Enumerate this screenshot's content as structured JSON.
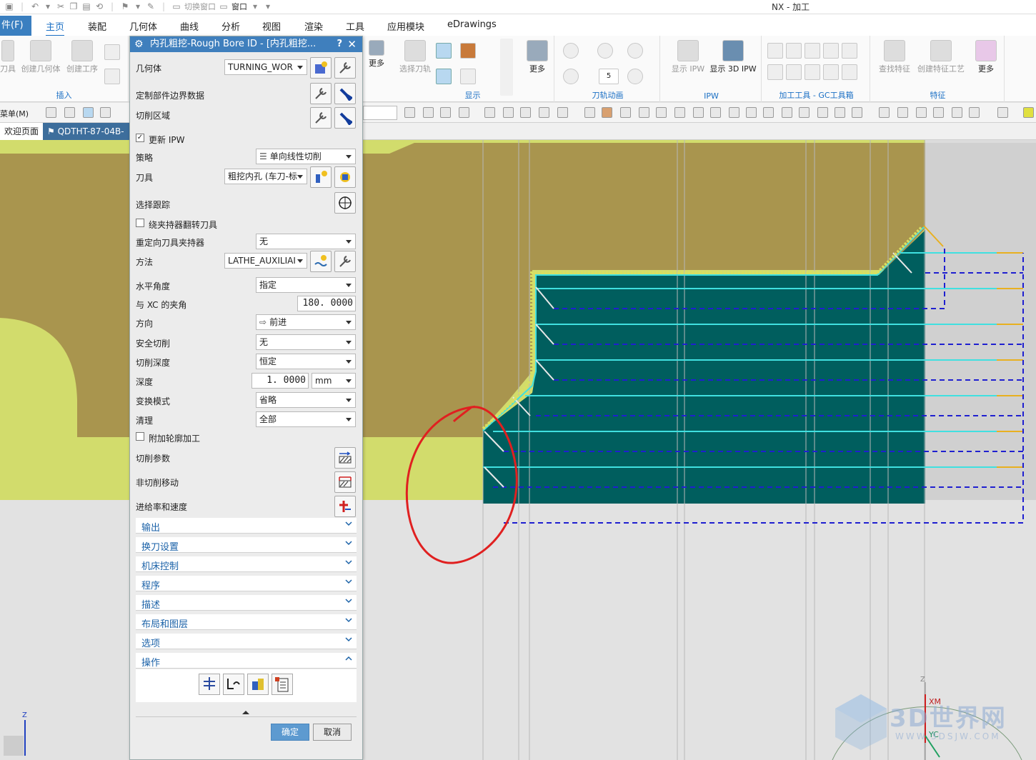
{
  "window": {
    "title": "NX - 加工"
  },
  "quick_access": {
    "switch_window": "切换窗口",
    "window_menu": "窗口"
  },
  "tabs": [
    {
      "label": "件(F)"
    },
    {
      "label": "主页"
    },
    {
      "label": "装配"
    },
    {
      "label": "几何体"
    },
    {
      "label": "曲线"
    },
    {
      "label": "分析"
    },
    {
      "label": "视图"
    },
    {
      "label": "渲染"
    },
    {
      "label": "工具"
    },
    {
      "label": "应用模块"
    },
    {
      "label": "eDrawings"
    }
  ],
  "ribbon": {
    "insert": {
      "label": "插入",
      "b1": "刀具",
      "b2": "创建几何体",
      "b3": "创建工序"
    },
    "display": {
      "label": "显示",
      "more": "更多",
      "select_path": "选择刀轨"
    },
    "anim": {
      "label": "刀轨动画",
      "more": "更多",
      "speed": "5"
    },
    "ipw": {
      "label": "IPW",
      "show_ipw": "显示 IPW",
      "show_3d_ipw": "显示 3D IPW"
    },
    "gc": {
      "label": "加工工具 - GC工具箱"
    },
    "feature": {
      "label": "特征",
      "find": "查找特征",
      "create": "创建特征工艺",
      "more": "更多"
    },
    "left_more": "更多"
  },
  "toolbar": {
    "menu": "菜单(M)"
  },
  "doctabs": {
    "home": "欢迎页面",
    "part": "QDTHT-87-04B-"
  },
  "dialog": {
    "title": "内孔粗挖-Rough Bore ID - [内孔粗挖...",
    "help": "?",
    "geometry": {
      "label": "几何体",
      "value": "TURNING_WOR"
    },
    "custom_boundary": {
      "label": "定制部件边界数据"
    },
    "cut_region": {
      "label": "切削区域"
    },
    "update_ipw": {
      "label": "更新 IPW",
      "checked": true
    },
    "strategy": {
      "label": "策略",
      "value": "单向线性切削"
    },
    "tool": {
      "label": "刀具",
      "value": "粗挖内孔 (车刀-标"
    },
    "select_trace": {
      "label": "选择跟踪"
    },
    "flip_tool": {
      "label": "绕夹持器翻转刀具",
      "checked": false
    },
    "reorient_holder": {
      "label": "重定向刀具夹持器",
      "value": "无"
    },
    "method": {
      "label": "方法",
      "value": "LATHE_AUXILIAI"
    },
    "level_angle": {
      "label": "水平角度",
      "value": "指定"
    },
    "xc_angle": {
      "label": "与 XC 的夹角",
      "value": "180. 0000"
    },
    "direction": {
      "label": "方向",
      "value": "前进"
    },
    "safe_cut": {
      "label": "安全切削",
      "value": "无"
    },
    "cut_depth": {
      "label": "切削深度",
      "value": "恒定"
    },
    "depth": {
      "label": "深度",
      "value": "1. 0000",
      "unit": "mm"
    },
    "transform_mode": {
      "label": "变换模式",
      "value": "省略"
    },
    "cleanup": {
      "label": "清理",
      "value": "全部"
    },
    "contour": {
      "label": "附加轮廓加工",
      "checked": false
    },
    "cut_params": {
      "label": "切削参数"
    },
    "non_cut": {
      "label": "非切削移动"
    },
    "feeds": {
      "label": "进给率和速度"
    },
    "sections": [
      {
        "label": "输出"
      },
      {
        "label": "换刀设置"
      },
      {
        "label": "机床控制"
      },
      {
        "label": "程序"
      },
      {
        "label": "描述"
      },
      {
        "label": "布局和图层"
      },
      {
        "label": "选项"
      },
      {
        "label": "操作"
      }
    ],
    "ok": "确定",
    "cancel": "取消"
  },
  "viewport": {
    "colors": {
      "stock": "#a9954e",
      "part": "#d2dc6c",
      "cut": "#005e5e",
      "path": "#40e0e0",
      "rapid": "#1f1fd0",
      "mark": "#e02020"
    },
    "triad": {
      "z": "Z",
      "xm": "XM",
      "yc": "YC"
    },
    "corner_z": "Z"
  },
  "watermark": {
    "big": "3D世界网",
    "small": "WWW.3DSJW.COM"
  }
}
